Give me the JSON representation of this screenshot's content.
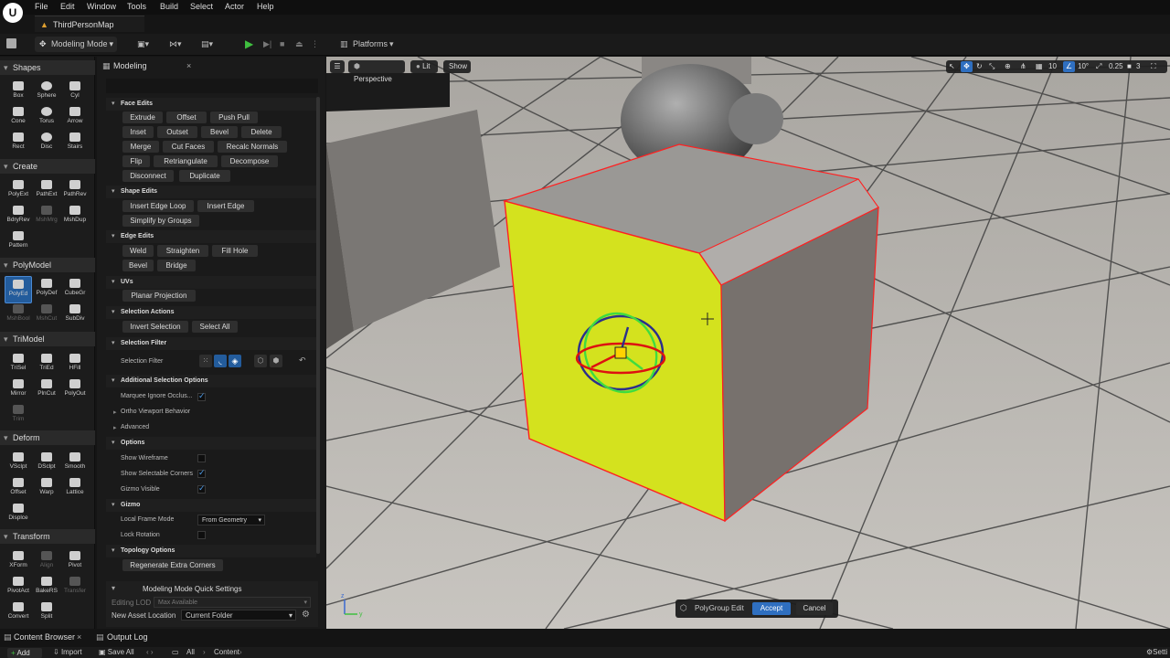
{
  "app": {
    "menu": [
      "File",
      "Edit",
      "Window",
      "Tools",
      "Build",
      "Select",
      "Actor",
      "Help"
    ],
    "map_tab": "ThirdPersonMap"
  },
  "toolbar": {
    "mode": "Modeling Mode",
    "platforms": "Platforms"
  },
  "palette": {
    "categories": {
      "shapes": "Shapes",
      "create": "Create",
      "polymodel": "PolyModel",
      "trimodel": "TriModel",
      "deform": "Deform",
      "transform": "Transform"
    },
    "shapes": [
      "Box",
      "Sphere",
      "Cyl",
      "Cone",
      "Torus",
      "Arrow",
      "Rect",
      "Disc",
      "Stairs"
    ],
    "create": [
      "PolyExt",
      "PathExt",
      "PathRev",
      "BdryRev",
      "MshMrg",
      "MshDup",
      "Pattern"
    ],
    "polymodel": [
      "PolyEd",
      "PolyDef",
      "CubeGr",
      "MshBool",
      "MshCut",
      "SubDiv"
    ],
    "trimodel": [
      "TriSel",
      "TriEd",
      "HFill",
      "Mirror",
      "PlnCut",
      "PolyOut",
      "Trim"
    ],
    "deform": [
      "VSclpt",
      "DSclpt",
      "Smooth",
      "Offset",
      "Warp",
      "Lattice",
      "Displce"
    ],
    "transform": [
      "XForm",
      "Align",
      "Pivot",
      "PivotAct",
      "BakeRS",
      "Transfer",
      "Convert",
      "Split"
    ]
  },
  "panel": {
    "tab": "Modeling",
    "face_edits": {
      "title": "Face Edits",
      "buttons": [
        "Extrude",
        "Offset",
        "Push Pull",
        "Inset",
        "Outset",
        "Bevel",
        "Delete",
        "Merge",
        "Cut Faces",
        "Recalc Normals",
        "Flip",
        "Retriangulate",
        "Decompose",
        "Disconnect",
        "Duplicate"
      ]
    },
    "shape_edits": {
      "title": "Shape Edits",
      "buttons": [
        "Insert Edge Loop",
        "Insert Edge",
        "Simplify by Groups"
      ]
    },
    "edge_edits": {
      "title": "Edge Edits",
      "buttons": [
        "Weld",
        "Straighten",
        "Fill Hole",
        "Bevel",
        "Bridge"
      ]
    },
    "uvs": {
      "title": "UVs",
      "buttons": [
        "Planar Projection"
      ]
    },
    "selection_actions": {
      "title": "Selection Actions",
      "buttons": [
        "Invert Selection",
        "Select All"
      ]
    },
    "selection_filter": {
      "title": "Selection Filter",
      "label": "Selection Filter"
    },
    "additional": {
      "title": "Additional Selection Options",
      "marquee": "Marquee Ignore Occlus...",
      "ortho": "Ortho Viewport Behavior",
      "advanced": "Advanced"
    },
    "options": {
      "title": "Options",
      "wireframe": "Show Wireframe",
      "corners": "Show Selectable Corners",
      "gizmo_visible": "Gizmo Visible"
    },
    "gizmo": {
      "title": "Gizmo",
      "local_frame_label": "Local Frame Mode",
      "local_frame_value": "From Geometry",
      "lock_rotation": "Lock Rotation"
    },
    "topology": {
      "title": "Topology Options",
      "button": "Regenerate Extra Corners"
    },
    "quick": {
      "title": "Modeling Mode Quick Settings",
      "lod_label": "Editing LOD",
      "lod_value": "Max Available",
      "asset_label": "New Asset Location",
      "asset_value": "Current Folder"
    }
  },
  "viewport": {
    "perspective": "Perspective",
    "lit": "Lit",
    "show": "Show",
    "grid": "10",
    "angle": "10°",
    "scale": "0.25",
    "cam": "3",
    "accept_bar": {
      "label": "PolyGroup Edit",
      "accept": "Accept",
      "cancel": "Cancel"
    }
  },
  "bottom": {
    "content_browser": "Content Browser",
    "output_log": "Output Log",
    "add": "Add",
    "import": "Import",
    "save_all": "Save All",
    "path": [
      "All",
      "Content"
    ],
    "settings": "Setti"
  }
}
